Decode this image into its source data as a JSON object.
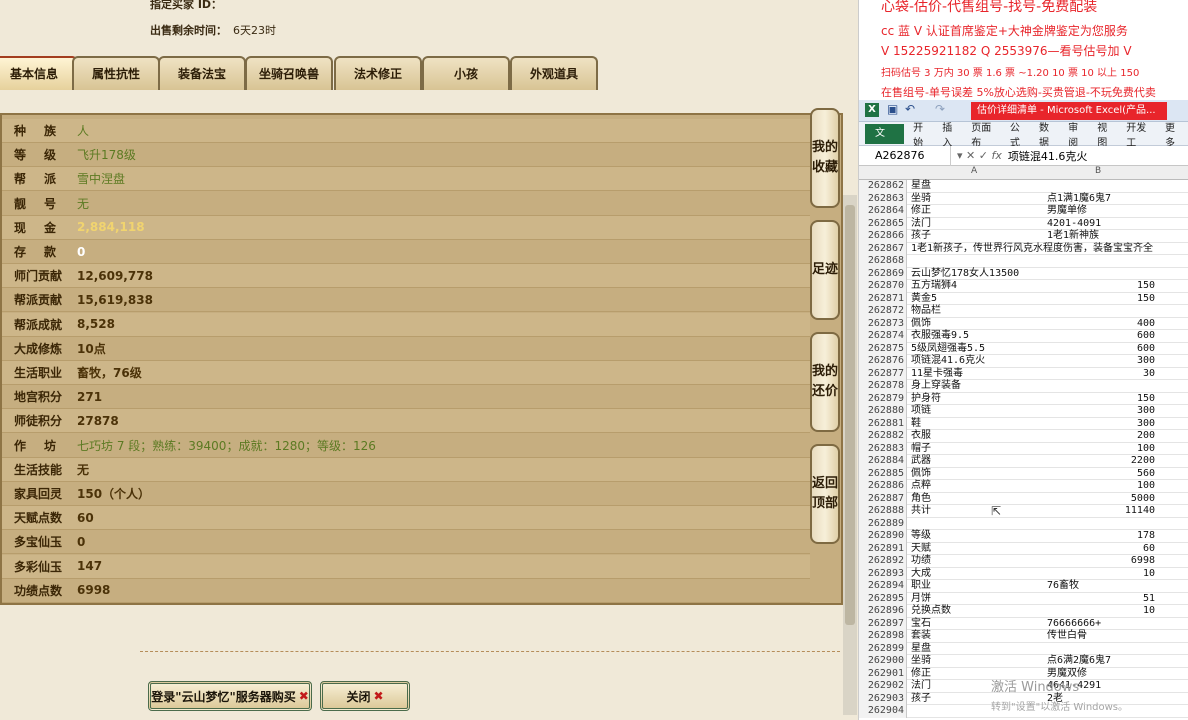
{
  "seller": {
    "buyer_label": "指定买家 ID：",
    "remaining_label": "出售剩余时间：",
    "remaining_value": "6天23时"
  },
  "tabs": [
    "基本信息",
    "属性抗性",
    "装备法宝",
    "坐骑召唤兽",
    "法术修正",
    "小孩",
    "外观道具"
  ],
  "rows": [
    {
      "label": "种族",
      "value": "人",
      "style": "green",
      "spaced": true
    },
    {
      "label": "等级",
      "value": "飞升178级",
      "style": "green",
      "spaced": true
    },
    {
      "label": "帮派",
      "value": "雪中涅盘",
      "style": "green",
      "spaced": true
    },
    {
      "label": "靓号",
      "value": "无",
      "style": "green",
      "spaced": true
    },
    {
      "label": "现金",
      "value": "2,884,118",
      "style": "gold",
      "spaced": true
    },
    {
      "label": "存款",
      "value": "0",
      "style": "white",
      "spaced": true
    },
    {
      "label": "师门贡献",
      "value": "12,609,778",
      "style": ""
    },
    {
      "label": "帮派贡献",
      "value": "15,619,838",
      "style": ""
    },
    {
      "label": "帮派成就",
      "value": "8,528",
      "style": ""
    },
    {
      "label": "大成修炼",
      "value": "10点",
      "style": ""
    },
    {
      "label": "生活职业",
      "value": "畜牧，76级",
      "style": ""
    },
    {
      "label": "地宫积分",
      "value": "271",
      "style": ""
    },
    {
      "label": "师徒积分",
      "value": "27878",
      "style": ""
    },
    {
      "label": "作坊",
      "value": "七巧坊 7 段；熟练：39400；成就：1280；等级：126",
      "style": "green",
      "spaced": true
    },
    {
      "label": "生活技能",
      "value": "无",
      "style": ""
    },
    {
      "label": "家具回灵",
      "value": "150（个人）",
      "style": ""
    },
    {
      "label": "天赋点数",
      "value": "60",
      "style": ""
    },
    {
      "label": "多宝仙玉",
      "value": "0",
      "style": ""
    },
    {
      "label": "多彩仙玉",
      "value": "147",
      "style": ""
    },
    {
      "label": "功绩点数",
      "value": "6998",
      "style": ""
    }
  ],
  "side_buttons": [
    "我的收藏",
    "足迹",
    "我的还价",
    "返回顶部"
  ],
  "buttons": {
    "login": "登录\"云山梦忆\"服务器购买",
    "close": "关闭"
  },
  "promo": [
    "心袋-估价-代售组号-找号-免费配装",
    "cc 蓝 V 认证首席鉴定+大神金牌鉴定为您服务",
    "V 15225921182     Q 2553976—看号估号加 V",
    "扫码估号 3 万内 30 票 1.6 票 ~1.20 10 票 10 以上 150",
    "在售组号-单号误差 5%放心选购-买贵管退-不玩免费代卖"
  ],
  "excel": {
    "title": "估价详细清单 - Microsoft Excel(产品...",
    "ribbon": [
      "开始",
      "插入",
      "页面布",
      "公式",
      "数据",
      "审阅",
      "视图",
      "开发工",
      "更多"
    ],
    "file_tab": "文件",
    "name_box": "A262876",
    "formula": "项链混41.6克火",
    "col_a": "A",
    "col_b": "B",
    "rows": [
      [
        "262862",
        "星盘",
        "",
        ""
      ],
      [
        "262863",
        "坐骑",
        "点1满1魔6鬼7",
        ""
      ],
      [
        "262864",
        "修正",
        "男魔单修",
        ""
      ],
      [
        "262865",
        "法门",
        "4201-4091",
        ""
      ],
      [
        "262866",
        "孩子",
        "1老1新神族",
        ""
      ],
      [
        "262867",
        "1老1新孩子，传世界行风克水程度伤害，装备宝宝齐全",
        "",
        ""
      ],
      [
        "262868",
        "",
        "",
        ""
      ],
      [
        "262869",
        "云山梦忆178女人13500",
        "",
        ""
      ],
      [
        "262870",
        "五方瑞狮4",
        "",
        "150"
      ],
      [
        "262871",
        "黄金5",
        "",
        "150"
      ],
      [
        "262872",
        "物品栏",
        "",
        ""
      ],
      [
        "262873",
        "佩饰",
        "",
        "400"
      ],
      [
        "262874",
        "衣服强毒9.5",
        "",
        "600"
      ],
      [
        "262875",
        "5级凤翅强毒5.5",
        "",
        "600"
      ],
      [
        "262876",
        "项链混41.6克火",
        "",
        "300"
      ],
      [
        "262877",
        "11星卡强毒",
        "",
        "30"
      ],
      [
        "262878",
        "身上穿装备",
        "",
        ""
      ],
      [
        "262879",
        "护身符",
        "",
        "150"
      ],
      [
        "262880",
        "项链",
        "",
        "300"
      ],
      [
        "262881",
        "鞋",
        "",
        "300"
      ],
      [
        "262882",
        "衣服",
        "",
        "200"
      ],
      [
        "262883",
        "帽子",
        "",
        "100"
      ],
      [
        "262884",
        "武器",
        "",
        "2200"
      ],
      [
        "262885",
        "佩饰",
        "",
        "560"
      ],
      [
        "262886",
        "点粹",
        "",
        "100"
      ],
      [
        "262887",
        "角色",
        "",
        "5000"
      ],
      [
        "262888",
        "共计",
        "",
        "11140"
      ],
      [
        "262889",
        "",
        "",
        ""
      ],
      [
        "262890",
        "等级",
        "",
        "178"
      ],
      [
        "262891",
        "天赋",
        "",
        "60"
      ],
      [
        "262892",
        "功绩",
        "",
        "6998"
      ],
      [
        "262893",
        "大成",
        "",
        "10"
      ],
      [
        "262894",
        "职业",
        "76畜牧",
        ""
      ],
      [
        "262895",
        "月饼",
        "",
        "51"
      ],
      [
        "262896",
        "兑换点数",
        "",
        "10"
      ],
      [
        "262897",
        "宝石",
        "76666666+",
        ""
      ],
      [
        "262898",
        "套装",
        "传世白骨",
        ""
      ],
      [
        "262899",
        "星盘",
        "",
        ""
      ],
      [
        "262900",
        "坐骑",
        "点6满2魔6鬼7",
        ""
      ],
      [
        "262901",
        "修正",
        "男魔双修",
        ""
      ],
      [
        "262902",
        "法门",
        "4641-4291",
        ""
      ],
      [
        "262903",
        "孩子",
        "2老",
        ""
      ],
      [
        "262904",
        "",
        "",
        ""
      ]
    ]
  },
  "watermark": {
    "line1": "激活 Windows",
    "line2": "转到\"设置\"以激活 Windows。"
  }
}
